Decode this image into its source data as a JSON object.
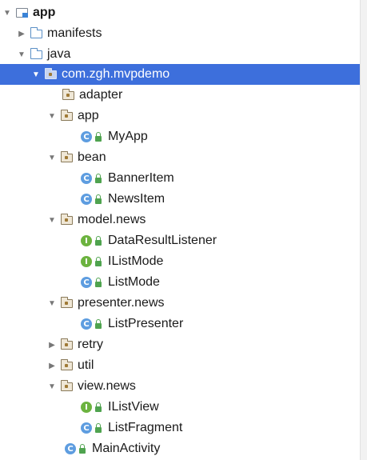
{
  "tree": {
    "app": "app",
    "manifests": "manifests",
    "java": "java",
    "package": "com.zgh.mvpdemo",
    "adapter": "adapter",
    "app_pkg": "app",
    "myapp": "MyApp",
    "bean": "bean",
    "banneritem": "BannerItem",
    "newsitem": "NewsItem",
    "model_news": "model.news",
    "dataresultlistener": "DataResultListener",
    "ilistmode": "IListMode",
    "listmode": "ListMode",
    "presenter_news": "presenter.news",
    "listpresenter": "ListPresenter",
    "retry": "retry",
    "util": "util",
    "view_news": "view.news",
    "ilistview": "IListView",
    "listfragment": "ListFragment",
    "mainactivity": "MainActivity"
  },
  "icons": {
    "class_letter": "C",
    "interface_letter": "I",
    "expanded": "▼",
    "collapsed": "▶"
  },
  "colors": {
    "selection": "#3d6fdc",
    "class_badge": "#5e9de0",
    "interface_badge": "#6cb33f"
  }
}
